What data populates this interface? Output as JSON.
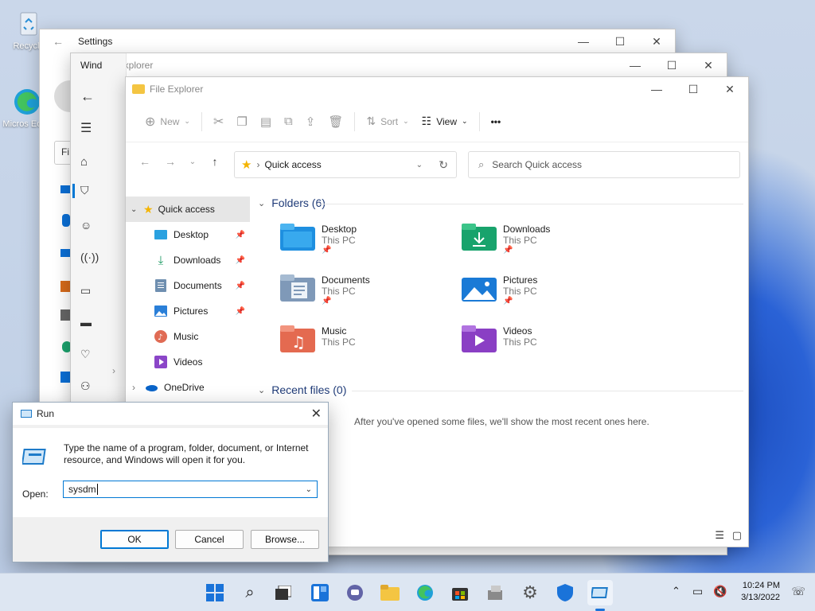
{
  "desktop": {
    "icons": [
      {
        "label": "Recycle"
      },
      {
        "label": "Micros Edge"
      }
    ]
  },
  "settings_window": {
    "title": "Settings",
    "find_placeholder": "Fi",
    "controls": {
      "minimize": "—",
      "maximize": "☐",
      "close": "✕"
    }
  },
  "explorer_back": {
    "title": "File Explorer",
    "left_fragment": "Wind"
  },
  "explorer": {
    "title": "File Explorer",
    "toolbar": {
      "new_label": "New",
      "sort_label": "Sort",
      "view_label": "View",
      "more_label": "•••"
    },
    "address": {
      "path": "Quick access"
    },
    "search": {
      "placeholder": "Search Quick access"
    },
    "nav": {
      "quick_access": "Quick access",
      "items": [
        {
          "label": "Desktop",
          "pinned": true,
          "icon": "desktop-folder-icon"
        },
        {
          "label": "Downloads",
          "pinned": true,
          "icon": "downloads-folder-icon"
        },
        {
          "label": "Documents",
          "pinned": true,
          "icon": "documents-folder-icon"
        },
        {
          "label": "Pictures",
          "pinned": true,
          "icon": "pictures-folder-icon"
        },
        {
          "label": "Music",
          "pinned": false,
          "icon": "music-folder-icon"
        },
        {
          "label": "Videos",
          "pinned": false,
          "icon": "videos-folder-icon"
        }
      ],
      "onedrive": "OneDrive"
    },
    "folders_header": "Folders (6)",
    "folders": [
      {
        "name": "Desktop",
        "location": "This PC"
      },
      {
        "name": "Downloads",
        "location": "This PC"
      },
      {
        "name": "Documents",
        "location": "This PC"
      },
      {
        "name": "Pictures",
        "location": "This PC"
      },
      {
        "name": "Music",
        "location": "This PC"
      },
      {
        "name": "Videos",
        "location": "This PC"
      }
    ],
    "recent_header": "Recent files (0)",
    "recent_empty": "After you've opened some files, we'll show the most recent ones here."
  },
  "run_dialog": {
    "title": "Run",
    "description": "Type the name of a program, folder, document, or Internet resource, and Windows will open it for you.",
    "open_label": "Open:",
    "open_value": "sysdm",
    "ok_label": "OK",
    "cancel_label": "Cancel",
    "browse_label": "Browse..."
  },
  "taskbar": {
    "apps": [
      "start-icon",
      "search-icon",
      "task-view-icon",
      "widgets-icon",
      "teams-chat-icon",
      "file-explorer-icon",
      "edge-icon",
      "store-icon",
      "control-panel-icon",
      "settings-icon",
      "security-icon",
      "run-icon"
    ],
    "clock_time": "10:24 PM",
    "clock_date": "3/13/2022"
  },
  "colors": {
    "accent": "#0078d4",
    "folder_yellow": "#f4c542"
  }
}
